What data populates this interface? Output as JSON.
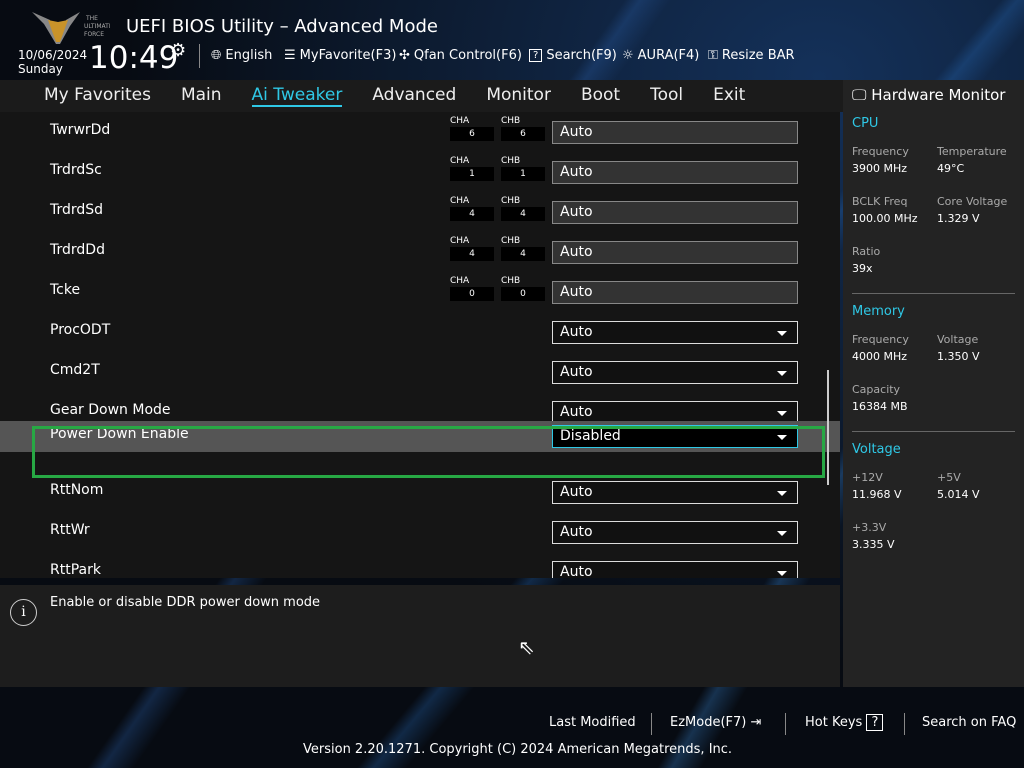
{
  "header": {
    "title": "UEFI BIOS Utility – Advanced Mode",
    "logo_text": "THE ULTIMATE FORCE",
    "date": "10/06/2024",
    "day": "Sunday",
    "time": "10:49",
    "tools": [
      {
        "icon": "globe-icon",
        "label": "English"
      },
      {
        "icon": "favorite-list-icon",
        "label": "MyFavorite(F3)"
      },
      {
        "icon": "fan-icon",
        "label": "Qfan Control(F6)"
      },
      {
        "icon": "search-help-icon",
        "label": "Search(F9)"
      },
      {
        "icon": "aura-icon",
        "label": "AURA(F4)"
      },
      {
        "icon": "resize-bar-icon",
        "label": "Resize BAR"
      }
    ]
  },
  "nav": {
    "tabs": [
      "My Favorites",
      "Main",
      "Ai Tweaker",
      "Advanced",
      "Monitor",
      "Boot",
      "Tool",
      "Exit"
    ],
    "active": "Ai Tweaker"
  },
  "settings": [
    {
      "label": "TwrwrDd",
      "cha": "6",
      "chb": "6",
      "value": "Auto",
      "type": "text"
    },
    {
      "label": "TrdrdSc",
      "cha": "1",
      "chb": "1",
      "value": "Auto",
      "type": "text"
    },
    {
      "label": "TrdrdSd",
      "cha": "4",
      "chb": "4",
      "value": "Auto",
      "type": "text"
    },
    {
      "label": "TrdrdDd",
      "cha": "4",
      "chb": "4",
      "value": "Auto",
      "type": "text"
    },
    {
      "label": "Tcke",
      "cha": "0",
      "chb": "0",
      "value": "Auto",
      "type": "text"
    },
    {
      "label": "ProcODT",
      "value": "Auto",
      "type": "dropdown"
    },
    {
      "label": "Cmd2T",
      "value": "Auto",
      "type": "dropdown"
    },
    {
      "label": "Gear Down Mode",
      "value": "Auto",
      "type": "dropdown"
    },
    {
      "label": "Power Down Enable",
      "value": "Disabled",
      "type": "dropdown",
      "selected": true
    },
    {
      "label": "RttNom",
      "value": "Auto",
      "type": "dropdown"
    },
    {
      "label": "RttWr",
      "value": "Auto",
      "type": "dropdown"
    },
    {
      "label": "RttPark",
      "value": "Auto",
      "type": "dropdown"
    }
  ],
  "channel_labels": {
    "a": "CHA",
    "b": "CHB"
  },
  "help": {
    "text": "Enable or disable DDR power down mode"
  },
  "hardware_monitor": {
    "title": "Hardware Monitor",
    "cpu": {
      "title": "CPU",
      "items": [
        [
          "Frequency",
          "3900 MHz"
        ],
        [
          "Temperature",
          "49°C"
        ],
        [
          "BCLK Freq",
          "100.00 MHz"
        ],
        [
          "Core Voltage",
          "1.329 V"
        ],
        [
          "Ratio",
          "39x"
        ]
      ]
    },
    "memory": {
      "title": "Memory",
      "items": [
        [
          "Frequency",
          "4000 MHz"
        ],
        [
          "Voltage",
          "1.350 V"
        ],
        [
          "Capacity",
          "16384 MB"
        ]
      ]
    },
    "voltage": {
      "title": "Voltage",
      "items": [
        [
          "+12V",
          "11.968 V"
        ],
        [
          "+5V",
          "5.014 V"
        ],
        [
          "+3.3V",
          "3.335 V"
        ]
      ]
    }
  },
  "footer": {
    "last_modified": "Last Modified",
    "ezmode": "EzMode(F7)",
    "hotkeys": "Hot Keys",
    "hotkeys_glyph": "?",
    "faq": "Search on FAQ",
    "version": "Version 2.20.1271. Copyright (C) 2024 American Megatrends, Inc."
  },
  "colors": {
    "accent": "#2fc8e6",
    "highlight_border": "#27a844"
  }
}
